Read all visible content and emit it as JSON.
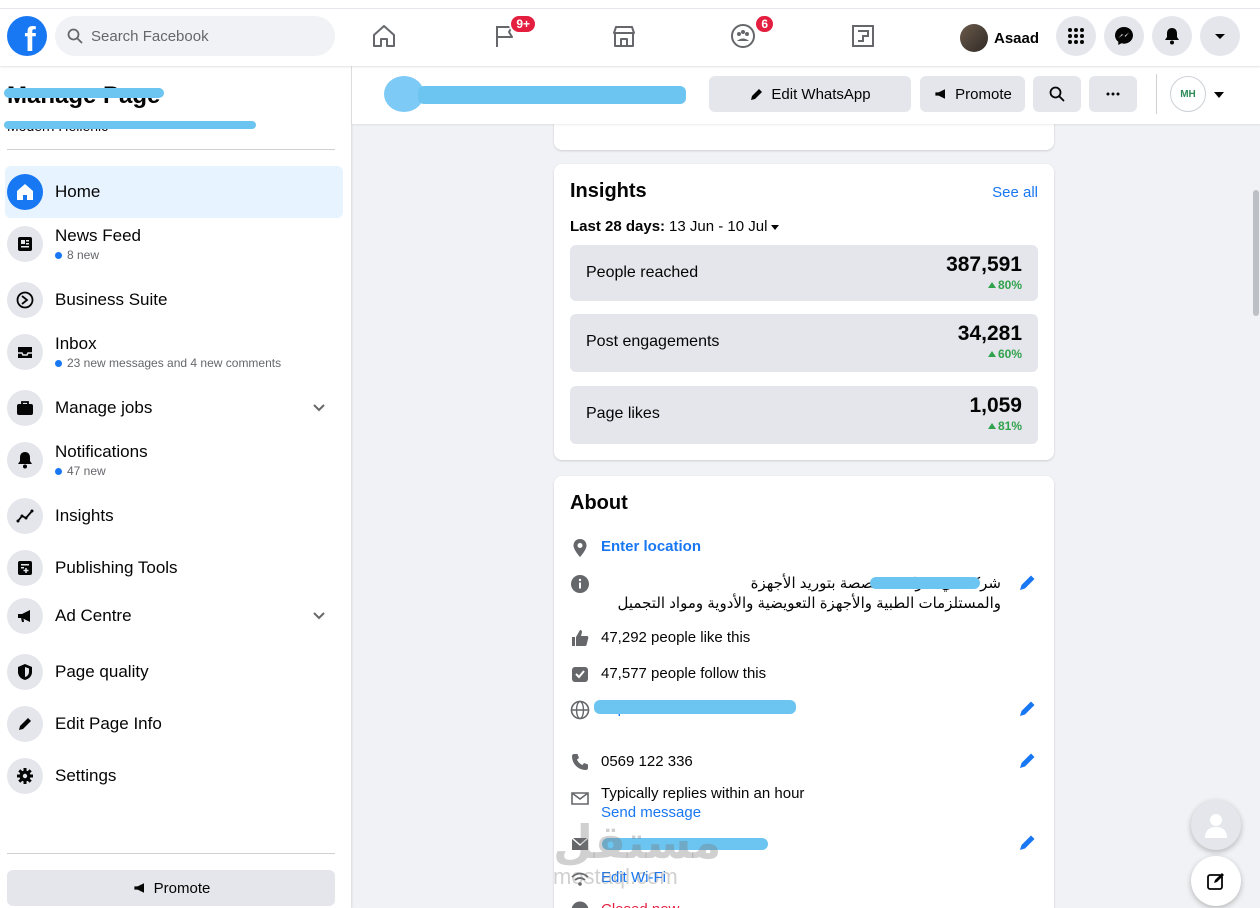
{
  "topbar": {
    "search_placeholder": "Search Facebook",
    "groups_badge": "9+",
    "gaming_badge": "6",
    "profile_name": "Asaad"
  },
  "sidebar": {
    "title": "Manage Page",
    "subtitle": "Modern Hellenic",
    "items": [
      {
        "label": "Home",
        "meta": ""
      },
      {
        "label": "News Feed",
        "meta": "8 new"
      },
      {
        "label": "Business Suite",
        "meta": ""
      },
      {
        "label": "Inbox",
        "meta": "23 new messages and 4 new comments"
      },
      {
        "label": "Manage jobs",
        "meta": ""
      },
      {
        "label": "Notifications",
        "meta": "47 new"
      },
      {
        "label": "Insights",
        "meta": ""
      },
      {
        "label": "Publishing Tools",
        "meta": ""
      },
      {
        "label": "Ad Centre",
        "meta": ""
      },
      {
        "label": "Page quality",
        "meta": ""
      },
      {
        "label": "Edit Page Info",
        "meta": ""
      },
      {
        "label": "Settings",
        "meta": ""
      }
    ],
    "promote_label": "Promote"
  },
  "pagebar": {
    "edit_whatsapp_label": "Edit WhatsApp",
    "promote_label": "Promote",
    "logo_text": "MH"
  },
  "insights": {
    "title": "Insights",
    "see_all": "See all",
    "range_label": "Last 28 days:",
    "range_value": "13 Jun - 10 Jul",
    "stats": [
      {
        "label": "People reached",
        "value": "387,591",
        "change": "80%"
      },
      {
        "label": "Post engagements",
        "value": "34,281",
        "change": "60%"
      },
      {
        "label": "Page likes",
        "value": "1,059",
        "change": "81%"
      }
    ]
  },
  "about": {
    "title": "About",
    "enter_location": "Enter location",
    "description_line1": "شركة هي شركة متخصصة بتوريد الأجهزة",
    "description_line2": "والمستلزمات الطبية والأجهزة التعويضية والأدوية ومواد التجميل",
    "likes": "47,292 people like this",
    "follows": "47,577 people follow this",
    "website": "http://www.m",
    "phone": "0569 122 336",
    "reply_time": "Typically replies within an hour",
    "send_message": "Send message",
    "edit_wifi": "Edit Wi-Fi",
    "closed_now": "Closed now"
  },
  "watermark": {
    "main": "مستقل",
    "sub": "mostaql.com"
  },
  "colors": {
    "brand": "#1877f2",
    "positive": "#31a24c",
    "badge": "#e41e3f"
  }
}
